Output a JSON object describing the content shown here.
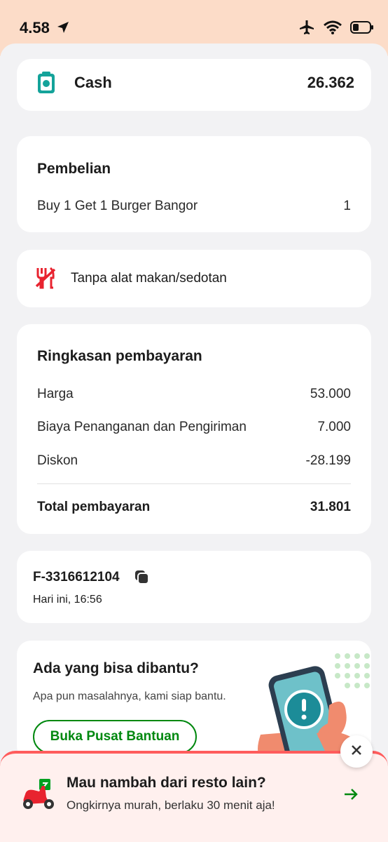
{
  "status_bar": {
    "time": "4.58"
  },
  "payment_method": {
    "label": "Cash",
    "amount": "26.362"
  },
  "purchase": {
    "title": "Pembelian",
    "items": [
      {
        "name": "Buy 1 Get 1 Burger Bangor",
        "qty": "1"
      }
    ]
  },
  "cutlery": {
    "label": "Tanpa alat makan/sedotan"
  },
  "summary": {
    "title": "Ringkasan pembayaran",
    "rows": [
      {
        "label": "Harga",
        "value": "53.000"
      },
      {
        "label": "Biaya Penanganan dan Pengiriman",
        "value": "7.000"
      },
      {
        "label": "Diskon",
        "value": "-28.199"
      }
    ],
    "total_label": "Total pembayaran",
    "total_value": "31.801"
  },
  "order": {
    "id": "F-3316612104",
    "time": "Hari ini, 16:56"
  },
  "help": {
    "title": "Ada yang bisa dibantu?",
    "subtitle": "Apa pun masalahnya, kami siap bantu.",
    "button": "Buka Pusat Bantuan"
  },
  "promo": {
    "title": "Mau nambah dari resto lain?",
    "subtitle": "Ongkirnya murah, berlaku 30 menit aja!"
  },
  "colors": {
    "brand_green": "#00880f",
    "accent_red": "#e8232f",
    "teal": "#14a39a"
  }
}
